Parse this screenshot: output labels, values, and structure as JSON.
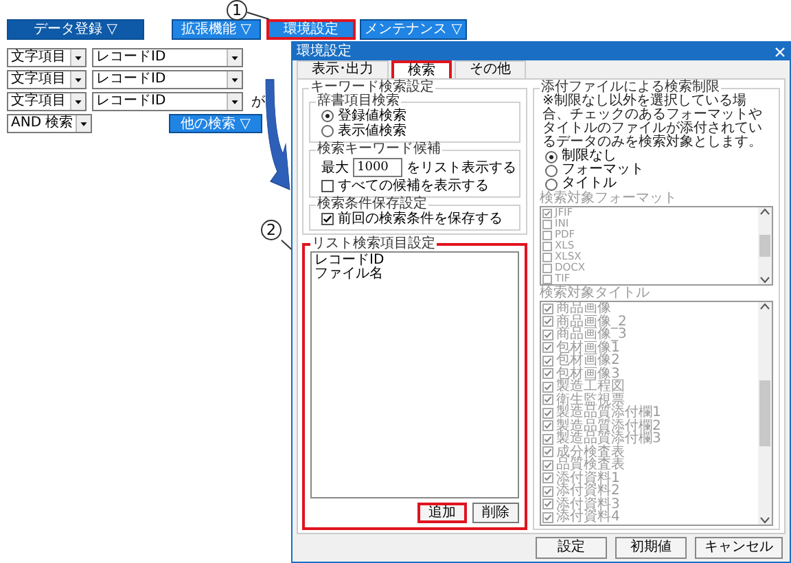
{
  "callouts": [
    {
      "label": "1"
    },
    {
      "label": "2"
    }
  ],
  "toolbar": {
    "buttons": [
      {
        "label": "データ登録 ▽",
        "kind": "dark",
        "highlighted": false
      },
      {
        "label": "拡張機能 ▽",
        "kind": "light",
        "highlighted": false
      },
      {
        "label": "環境設定",
        "kind": "light",
        "highlighted": true
      },
      {
        "label": "メンテナンス ▽",
        "kind": "light",
        "highlighted": false
      }
    ]
  },
  "conditions": [
    {
      "type": "文字項目",
      "field": "レコードID"
    },
    {
      "type": "文字項目",
      "field": "レコードID"
    },
    {
      "type": "文字項目",
      "field": "レコードID",
      "particle": "が"
    }
  ],
  "logic": "AND 検索",
  "other_search_button": "他の検索 ▽",
  "dialog": {
    "title": "環境設定",
    "tabs": [
      {
        "label": "表示･出力",
        "selected": false
      },
      {
        "label": "検索",
        "selected": true
      },
      {
        "label": "その他",
        "selected": false
      }
    ],
    "keyword_group": {
      "title": "キーワード検索設定",
      "dictionary": {
        "title": "辞書項目検索",
        "options": [
          {
            "label": "登録値検索",
            "selected": true
          },
          {
            "label": "表示値検索",
            "selected": false
          }
        ]
      },
      "candidates": {
        "title": "検索キーワード候補",
        "prefix": "最大",
        "max": "1000",
        "suffix": "をリスト表示する",
        "show_all": {
          "label": "すべての候補を表示する",
          "checked": false
        }
      },
      "save": {
        "title": "検索条件保存設定",
        "option": {
          "label": "前回の検索条件を保存する",
          "checked": true
        }
      }
    },
    "list_group": {
      "title": "リスト検索項目設定",
      "highlighted": true,
      "items": [
        "レコードID",
        "ファイル名"
      ],
      "buttons": [
        {
          "label": "追加",
          "highlighted": true
        },
        {
          "label": "削除",
          "highlighted": false
        }
      ]
    },
    "attachment_group": {
      "title": "添付ファイルによる検索制限",
      "note": "※制限なし以外を選択している場合、チェックのあるフォーマットやタイトルのファイルが添付されているデータのみを検索対象とします。",
      "options": [
        {
          "label": "制限なし",
          "selected": true
        },
        {
          "label": "フォーマット",
          "selected": false
        },
        {
          "label": "タイトル",
          "selected": false
        }
      ],
      "filters_disabled": true,
      "format_label": "検索対象フォーマット",
      "formats": [
        {
          "label": "JFIF",
          "checked": true
        },
        {
          "label": "INI",
          "checked": false
        },
        {
          "label": "PDF",
          "checked": false
        },
        {
          "label": "XLS",
          "checked": false
        },
        {
          "label": "XLSX",
          "checked": false
        },
        {
          "label": "DOCX",
          "checked": false
        },
        {
          "label": "TIF",
          "checked": false
        }
      ],
      "title_label": "検索対象タイトル",
      "titles": [
        {
          "label": "商品画像",
          "checked": true
        },
        {
          "label": "商品画像_2",
          "checked": true
        },
        {
          "label": "商品画像_3",
          "checked": true
        },
        {
          "label": "包材画像1",
          "checked": true
        },
        {
          "label": "包材画像2",
          "checked": true
        },
        {
          "label": "包材画像3",
          "checked": true
        },
        {
          "label": "製造工程図",
          "checked": true
        },
        {
          "label": "衛生監視票",
          "checked": true
        },
        {
          "label": "製造品質添付欄1",
          "checked": true
        },
        {
          "label": "製造品質添付欄2",
          "checked": true
        },
        {
          "label": "製造品質添付欄3",
          "checked": true
        },
        {
          "label": "成分検査表",
          "checked": true
        },
        {
          "label": "品質検査表",
          "checked": true
        },
        {
          "label": "添付資料1",
          "checked": true
        },
        {
          "label": "添付資料2",
          "checked": true
        },
        {
          "label": "添付資料3",
          "checked": true
        },
        {
          "label": "添付資料4",
          "checked": true
        }
      ]
    },
    "buttons": [
      "設定",
      "初期値",
      "キャンセル"
    ]
  }
}
